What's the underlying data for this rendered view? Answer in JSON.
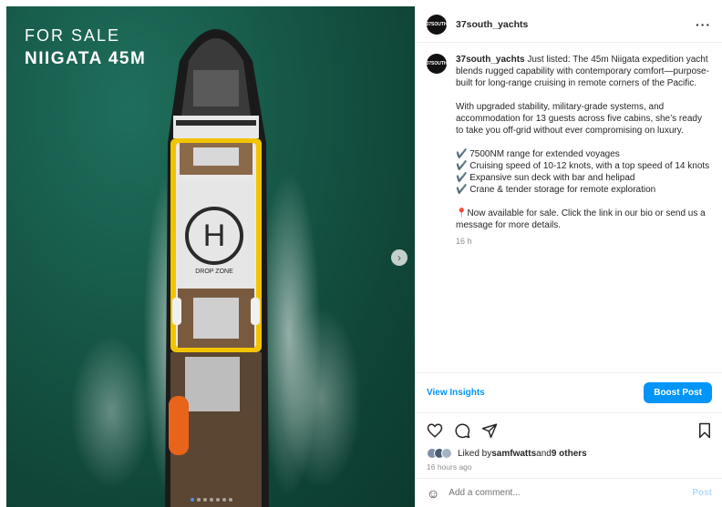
{
  "media": {
    "overlay_line1": "FOR SALE",
    "overlay_line2": "NIIGATA 45M",
    "helipad_letter": "H",
    "helipad_label": "DROP ZONE",
    "next_glyph": "›",
    "slide_count": 7,
    "active_slide": 1
  },
  "header": {
    "avatar_text": "37SOUTH",
    "username": "37south_yachts",
    "more_glyph": "···"
  },
  "caption": {
    "username": "37south_yachts",
    "intro": "Just listed: The 45m Niigata expedition yacht blends rugged capability with contemporary comfort—purpose-built for long-range cruising in remote corners of the Pacific.",
    "para2": "With upgraded stability, military-grade systems, and accommodation for 13 guests across five cabins, she’s ready to take you off-grid without ever compromising on luxury.",
    "features": [
      "✔️ 7500NM range for extended voyages",
      "✔️ Cruising speed of 10-12 knots, with a top speed of 14 knots",
      "✔️ Expansive sun deck with bar and helipad",
      "✔️ Crane & tender storage for remote exploration"
    ],
    "cta": "📍Now available for sale. Click the link in our bio or send us a message for more details.",
    "time": "16 h"
  },
  "insights": {
    "view_label": "View Insights",
    "boost_label": "Boost Post"
  },
  "likes": {
    "prefix": "Liked by ",
    "user": "samfwatts",
    "mid": " and ",
    "others": "9 others",
    "posted": "16 hours ago"
  },
  "comment": {
    "placeholder": "Add a comment...",
    "post_label": "Post"
  },
  "colors": {
    "accent": "#0095f6",
    "sea": "#175a4a",
    "hull": "#1a1a1a",
    "helipad_yellow": "#f2c400"
  }
}
